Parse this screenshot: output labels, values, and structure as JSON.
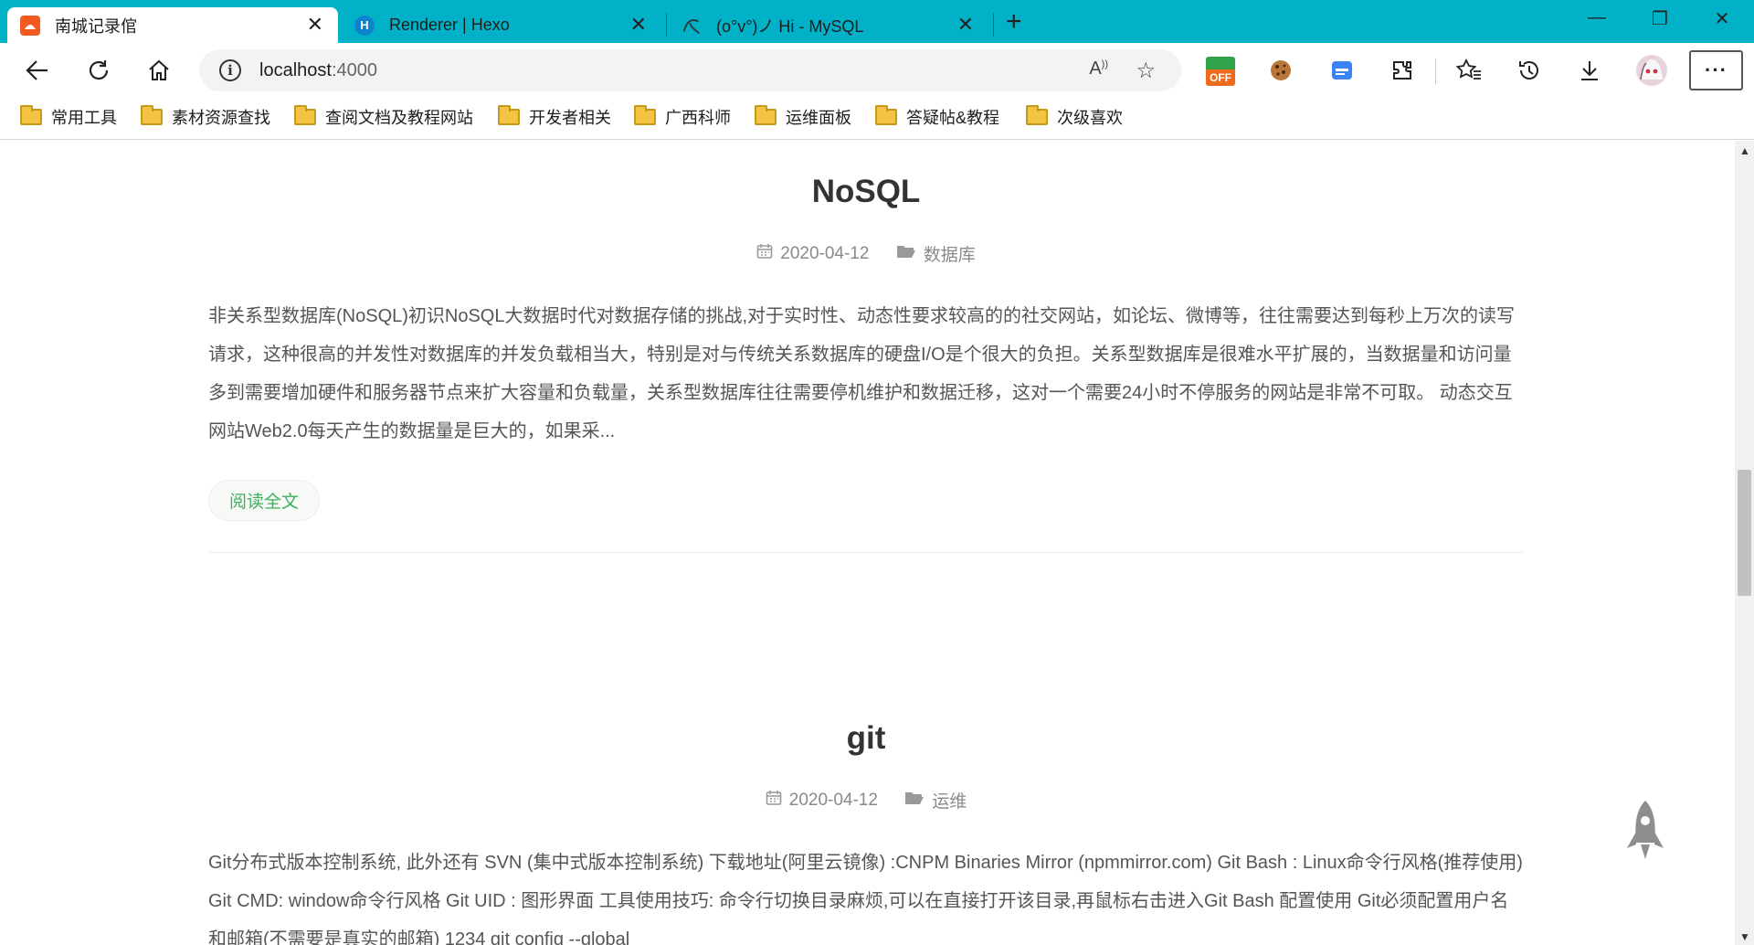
{
  "browser": {
    "tabs": [
      {
        "title": "南城记录倌",
        "favicon": "news-favicon",
        "favicon_color": "#f25a22",
        "active": true
      },
      {
        "title": "Renderer | Hexo",
        "favicon": "hexo-favicon",
        "favicon_color": "#0e83cd",
        "active": false
      },
      {
        "title": "(o°v°)ノ Hi - MySQL",
        "favicon": "mysql-favicon",
        "active": false
      }
    ],
    "new_tab_label": "+",
    "address": {
      "host": "localhost",
      "port": ":4000"
    },
    "extensions": {
      "off_badge": "OFF"
    }
  },
  "bookmarks": [
    {
      "label": "常用工具",
      "icon": "folder-icon"
    },
    {
      "label": "素材资源查找",
      "icon": "folder-icon"
    },
    {
      "label": "查阅文档及教程网站",
      "icon": "folder-icon"
    },
    {
      "label": "开发者相关",
      "icon": "folder-icon"
    },
    {
      "label": "广西科师",
      "icon": "folder-icon"
    },
    {
      "label": "运维面板",
      "icon": "folder-icon"
    },
    {
      "label": "答疑帖&教程",
      "icon": "folder-icon"
    },
    {
      "label": "次级喜欢",
      "icon": "folder-icon"
    }
  ],
  "posts": [
    {
      "title": "NoSQL",
      "date": "2020-04-12",
      "category": "数据库",
      "excerpt": "非关系型数据库(NoSQL)初识NoSQL大数据时代对数据存储的挑战,对于实时性、动态性要求较高的的社交网站，如论坛、微博等，往往需要达到每秒上万次的读写请求，这种很高的并发性对数据库的并发负载相当大，特别是对与传统关系数据库的硬盘I/O是个很大的负担。关系型数据库是很难水平扩展的，当数据量和访问量多到需要增加硬件和服务器节点来扩大容量和负载量，关系型数据库往往需要停机维护和数据迁移，这对一个需要24小时不停服务的网站是非常不可取。 动态交互网站Web2.0每天产生的数据量是巨大的，如果采...",
      "read_more": "阅读全文"
    },
    {
      "title": "git",
      "date": "2020-04-12",
      "category": "运维",
      "excerpt": "Git分布式版本控制系统, 此外还有 SVN (集中式版本控制系统) 下载地址(阿里云镜像) :CNPM Binaries Mirror (npmmirror.com) Git Bash : Linux命令行风格(推荐使用) Git CMD: window命令行风格 Git UID : 图形界面 工具使用技巧: 命令行切换目录麻烦,可以在直接打开该目录,再鼠标右击进入Git Bash 配置使用 Git必须配置用户名和邮箱(不需要是真实的邮箱) 1234 git config --global"
    }
  ],
  "colors": {
    "tab_strip": "#00b1c7",
    "accent_green": "#3fae5d"
  }
}
